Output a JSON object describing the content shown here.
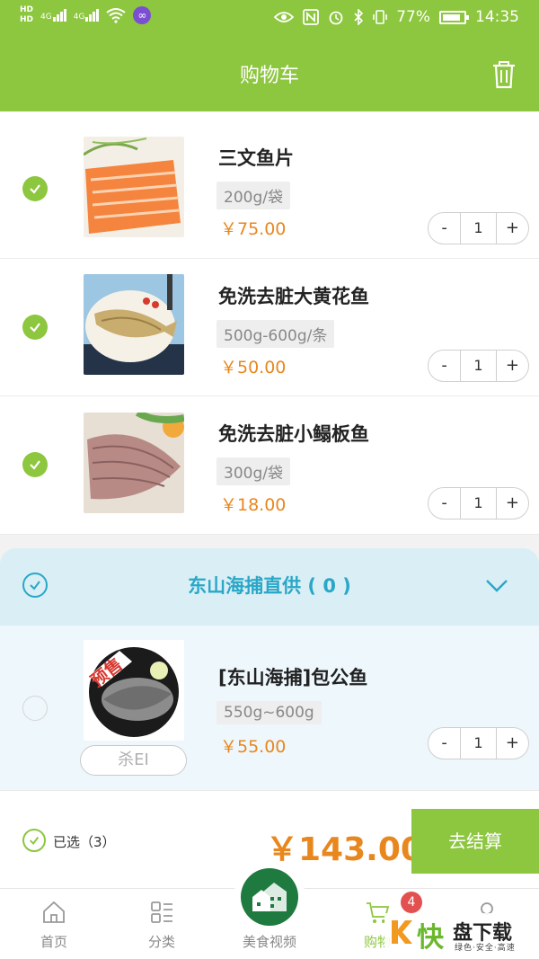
{
  "status_bar": {
    "hd1": "HD",
    "hd2": "HD",
    "net1": "4G",
    "net2": "4G",
    "battery_pct": "77%",
    "time": "14:35"
  },
  "header": {
    "title": "购物车",
    "trash_icon": "trash-icon"
  },
  "cart": {
    "items": [
      {
        "name": "三文鱼片",
        "spec": "200g/袋",
        "price": "￥75.00",
        "qty": "1",
        "selected": true
      },
      {
        "name": "免洗去脏大黄花鱼",
        "spec": "500g-600g/条",
        "price": "￥50.00",
        "qty": "1",
        "selected": true
      },
      {
        "name": "免洗去脏小鳎板鱼",
        "spec": "300g/袋",
        "price": "￥18.00",
        "qty": "1",
        "selected": true
      }
    ],
    "stepper": {
      "minus": "-",
      "plus": "+"
    }
  },
  "group": {
    "title": "东山海捕直供 ( 0 )",
    "items": [
      {
        "name": "[东山海捕]包公鱼",
        "spec": "550g~600g",
        "price": "￥55.00",
        "qty": "1",
        "tag": "杀EI",
        "image_label": "预售"
      }
    ]
  },
  "footer": {
    "selected_label": "已选（3）",
    "total": "￥143.00",
    "checkout_label": "去结算"
  },
  "tabbar": {
    "tabs": [
      {
        "label": "首页",
        "icon": "home-icon"
      },
      {
        "label": "分类",
        "icon": "category-icon"
      },
      {
        "label": "美食视频",
        "icon": "video-icon"
      },
      {
        "label": "购物",
        "icon": "cart-icon",
        "active": true
      },
      {
        "label": "",
        "icon": "user-icon"
      }
    ],
    "cart_badge": "4"
  },
  "watermark": {
    "brand": "快",
    "name": "盘下载",
    "slogan": "绿色·安全·高速"
  },
  "colors": {
    "brand_green": "#8dc63f",
    "price_orange": "#e8871e",
    "group_blue": "#2aa7c8"
  }
}
